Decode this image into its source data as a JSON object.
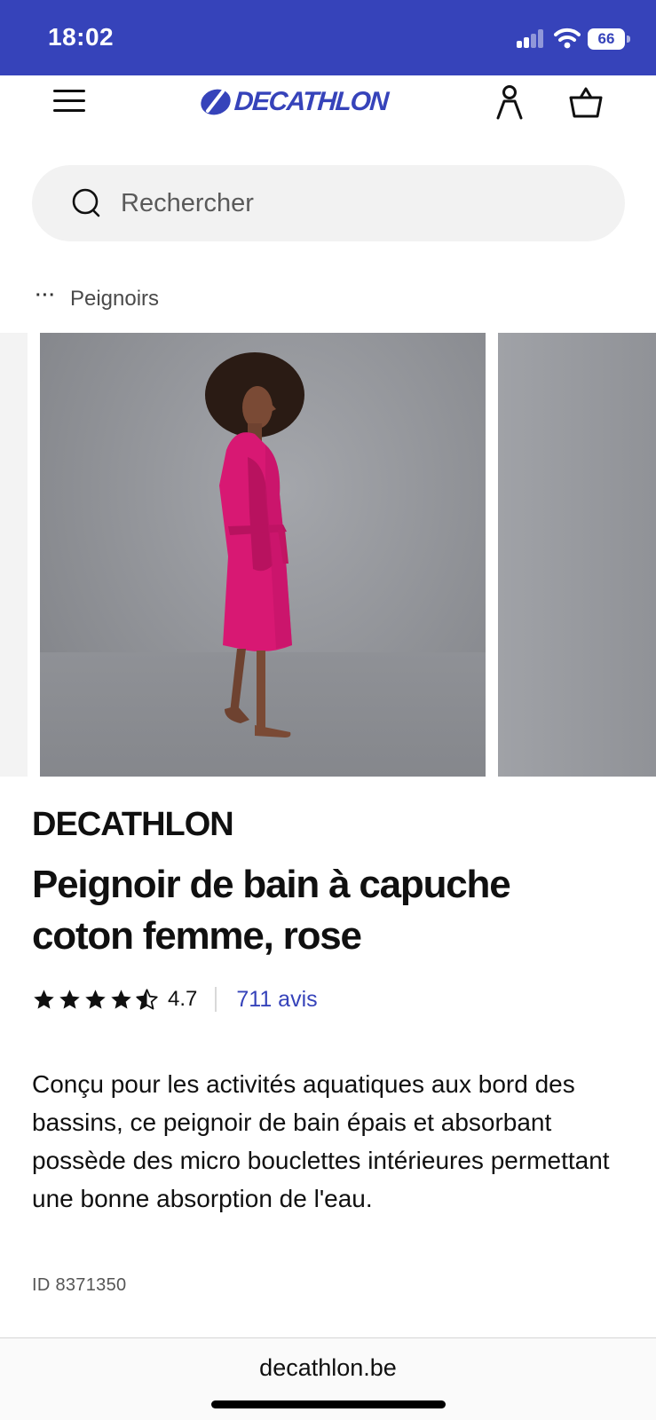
{
  "status_bar": {
    "time": "18:02",
    "battery": "66",
    "icons": [
      "signal-icon",
      "wifi-icon",
      "battery-icon"
    ]
  },
  "header": {
    "logo_text": "DECATHLON",
    "brand_color": "#3643ba",
    "icons": [
      "menu-icon",
      "account-icon",
      "cart-icon"
    ]
  },
  "search": {
    "placeholder": "Rechercher",
    "icon": "search-icon"
  },
  "breadcrumb": {
    "more_label": "···",
    "current": "Peignoirs"
  },
  "product": {
    "brand": "DECATHLON",
    "title": "Peignoir de bain à capuche coton femme, rose",
    "rating": {
      "stars": 4.5,
      "value": "4.7",
      "reviews_label": "711 avis"
    },
    "description": "Conçu pour les activités aquatiques aux bord des bassins, ce peignoir de bain épais et absorbant possède des micro bouclettes intérieures permettant une bonne absorption de l'eau.",
    "id_label": "ID 8371350",
    "robe_color": "#d81873"
  },
  "browser": {
    "url": "decathlon.be"
  }
}
